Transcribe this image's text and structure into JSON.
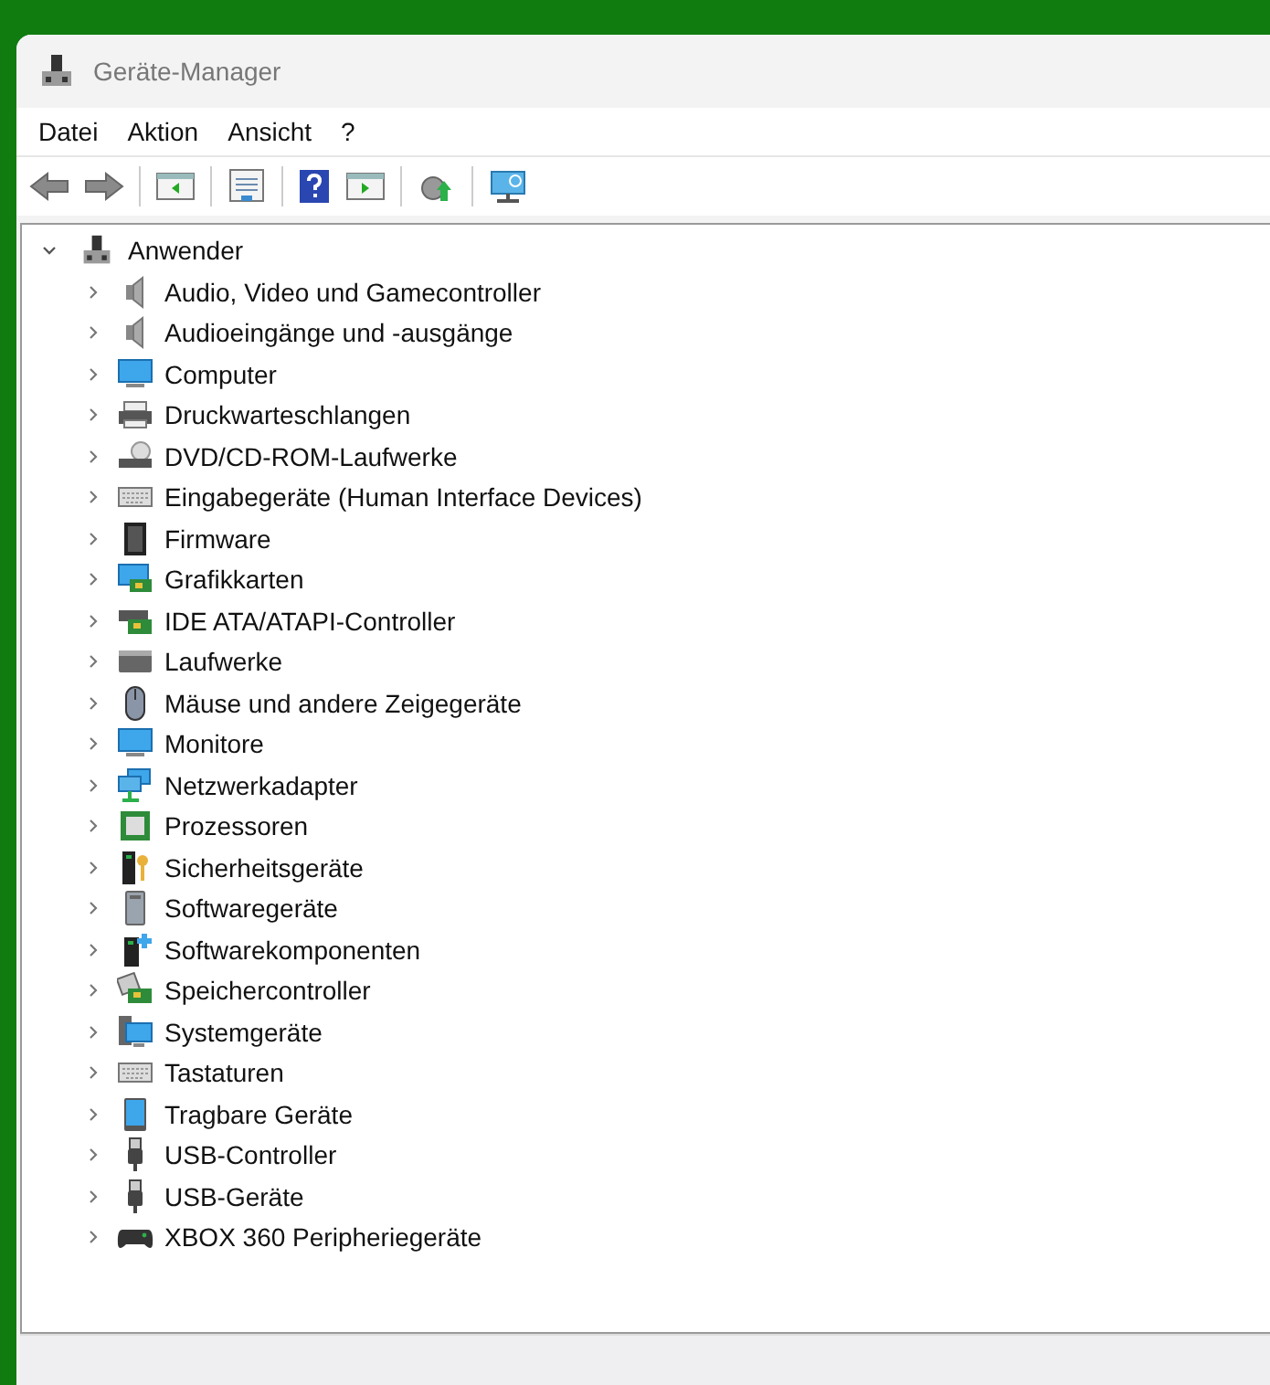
{
  "window": {
    "title": "Geräte-Manager"
  },
  "menu": [
    {
      "label": "Datei"
    },
    {
      "label": "Aktion"
    },
    {
      "label": "Ansicht"
    },
    {
      "label": "?"
    }
  ],
  "tree": {
    "label": "Anwender",
    "expanded": true,
    "children": [
      {
        "label": "Audio, Video und Gamecontroller",
        "expanded": false
      },
      {
        "label": "Audioeingänge und -ausgänge",
        "expanded": false
      },
      {
        "label": "Computer",
        "expanded": false
      },
      {
        "label": "Druckwarteschlangen",
        "expanded": false
      },
      {
        "label": "DVD/CD-ROM-Laufwerke",
        "expanded": false
      },
      {
        "label": "Eingabegeräte (Human Interface Devices)",
        "expanded": false
      },
      {
        "label": "Firmware",
        "expanded": false
      },
      {
        "label": "Grafikkarten",
        "expanded": false
      },
      {
        "label": "IDE ATA/ATAPI-Controller",
        "expanded": false
      },
      {
        "label": "Laufwerke",
        "expanded": false
      },
      {
        "label": "Mäuse und andere Zeigegeräte",
        "expanded": false
      },
      {
        "label": "Monitore",
        "expanded": false
      },
      {
        "label": "Netzwerkadapter",
        "expanded": false
      },
      {
        "label": "Prozessoren",
        "expanded": false
      },
      {
        "label": "Sicherheitsgeräte",
        "expanded": false
      },
      {
        "label": "Softwaregeräte",
        "expanded": false
      },
      {
        "label": "Softwarekomponenten",
        "expanded": false
      },
      {
        "label": "Speichercontroller",
        "expanded": false
      },
      {
        "label": "Systemgeräte",
        "expanded": false
      },
      {
        "label": "Tastaturen",
        "expanded": false
      },
      {
        "label": "Tragbare Geräte",
        "expanded": false
      },
      {
        "label": "USB-Controller",
        "expanded": false
      },
      {
        "label": "USB-Geräte",
        "expanded": false
      },
      {
        "label": "XBOX 360 Peripheriegeräte",
        "expanded": false
      }
    ]
  }
}
